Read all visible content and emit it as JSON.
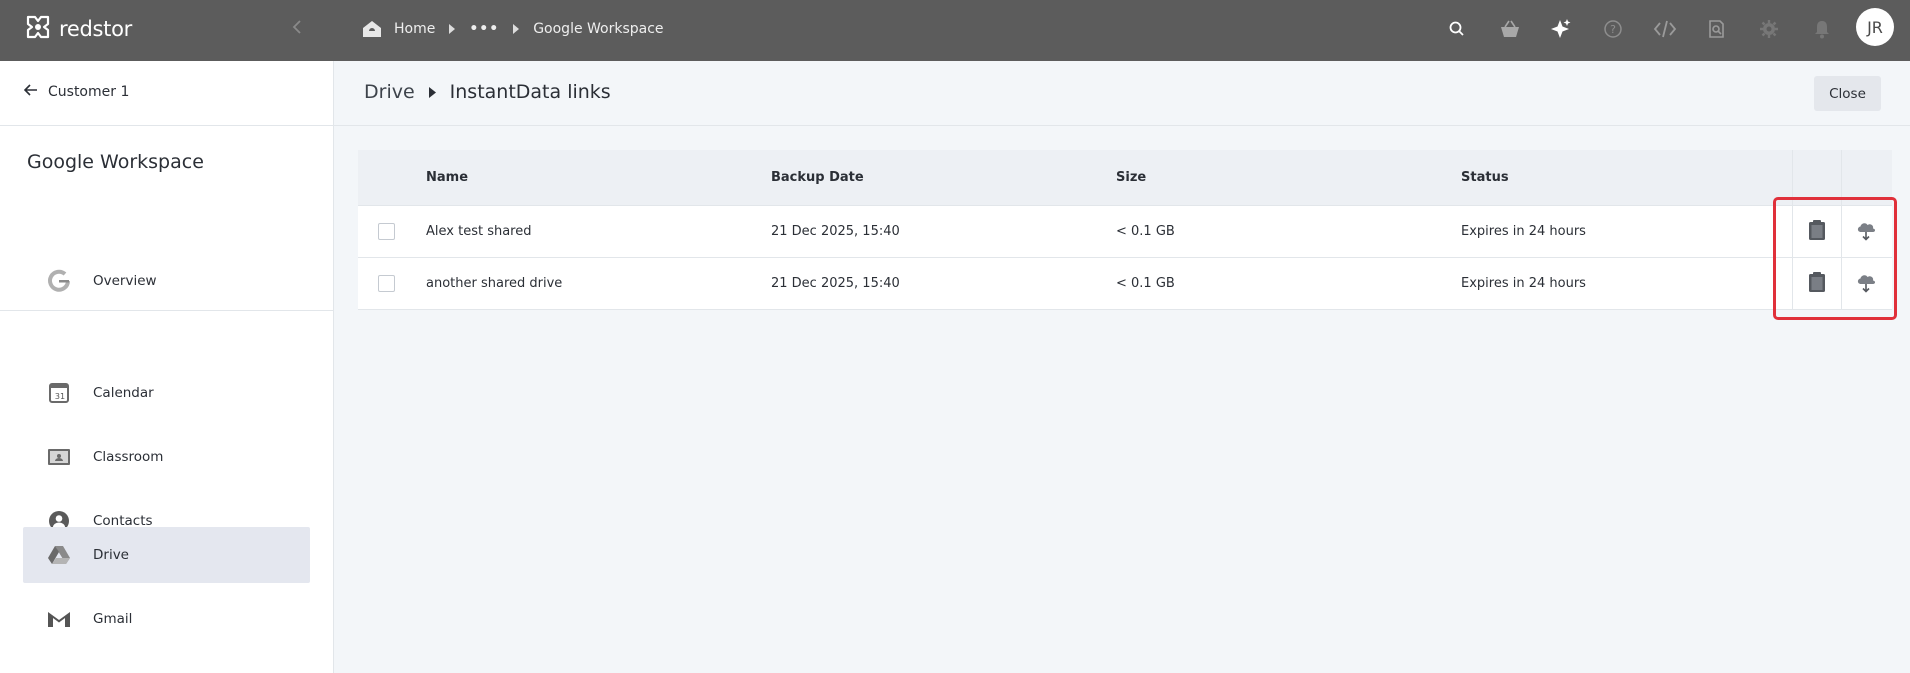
{
  "app": {
    "logo_text": "redstor",
    "logo_icon": "redstor-logo-icon"
  },
  "topbar": {
    "collapse_icon": "chevron-left-icon",
    "breadcrumb": {
      "home": "Home",
      "ellipsis": "•••",
      "current": "Google Workspace"
    },
    "icons": [
      "search-icon",
      "basket-icon",
      "sparkle-icon",
      "help-icon",
      "code-icon",
      "search-document-icon",
      "gear-icon",
      "bell-icon"
    ],
    "avatar_initials": "JR"
  },
  "sidebar": {
    "back_label": "Customer 1",
    "title": "Google Workspace",
    "items": [
      {
        "label": "Overview",
        "icon": "google-icon"
      },
      {
        "label": "Calendar",
        "icon": "calendar-icon"
      },
      {
        "label": "Classroom",
        "icon": "classroom-icon"
      },
      {
        "label": "Contacts",
        "icon": "contacts-icon"
      },
      {
        "label": "Drive",
        "icon": "drive-icon",
        "active": true
      },
      {
        "label": "Gmail",
        "icon": "gmail-icon"
      }
    ]
  },
  "page": {
    "breadcrumb_parent": "Drive",
    "breadcrumb_current": "InstantData links",
    "close_label": "Close"
  },
  "table": {
    "columns": [
      "Name",
      "Backup Date",
      "Size",
      "Status"
    ],
    "rows": [
      {
        "name": "Alex test shared",
        "backup_date": "21 Dec 2025, 15:40",
        "size": "< 0.1 GB",
        "status": "Expires in 24 hours"
      },
      {
        "name": "another shared drive",
        "backup_date": "21 Dec 2025, 15:40",
        "size": "< 0.1 GB",
        "status": "Expires in 24 hours"
      }
    ],
    "row_actions": [
      "clipboard-icon",
      "cloud-download-icon"
    ]
  },
  "colors": {
    "topbar": "#5c5c5c",
    "sidebar_active": "#e4e7ef",
    "highlight": "#e0303a",
    "background": "#f3f6f9"
  }
}
